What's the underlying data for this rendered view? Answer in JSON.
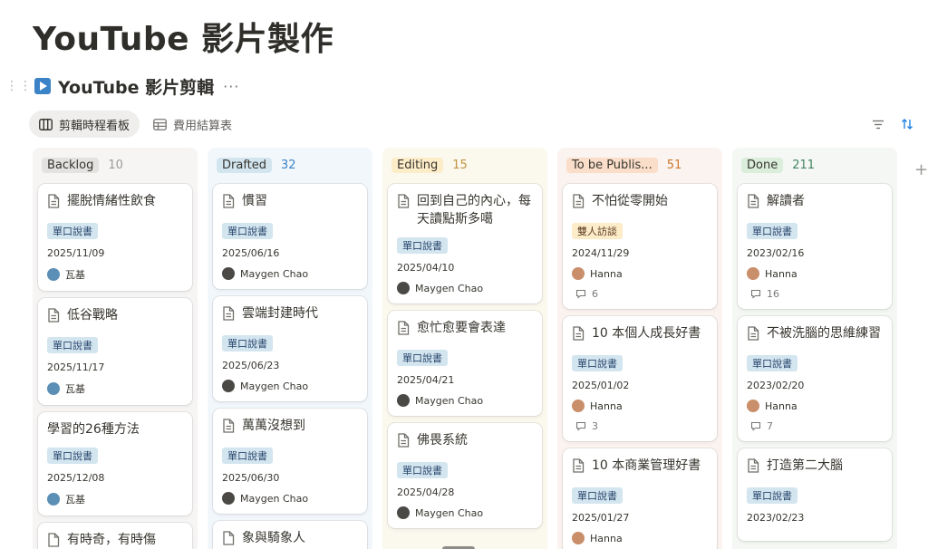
{
  "page": {
    "title": "YouTube 影片製作"
  },
  "database": {
    "title": "YouTube 影片剪輯",
    "more": "···"
  },
  "views": [
    {
      "label": "剪輯時程看板",
      "icon": "board-icon",
      "active": true
    },
    {
      "label": "費用結算表",
      "icon": "table-icon",
      "active": false
    }
  ],
  "toolbar": {
    "filter_icon": "filter-icon",
    "sort_icon": "sort-icon"
  },
  "colors": {
    "backlog_bg": "#f6f5f4",
    "backlog_tag": "#e3e2e0",
    "drafted_bg": "#f2f7fc",
    "drafted_tag": "#d3e5ef",
    "drafted_count": "#3b83c6",
    "editing_bg": "#fbf8ee",
    "editing_tag": "#fdecc8",
    "editing_count": "#c29343",
    "publish_bg": "#fbf3ef",
    "publish_tag": "#fadec9",
    "publish_count": "#cc782f",
    "done_bg": "#f4f7f3",
    "done_tag": "#dbeddb",
    "done_count": "#448361"
  },
  "columns": [
    {
      "label": "Backlog",
      "count": "10",
      "cards": [
        {
          "title": "擺脫情緒性飲食",
          "tag": "單口說書",
          "date": "2025/11/09",
          "person": "瓦基"
        },
        {
          "title": "低谷戰略",
          "tag": "單口說書",
          "date": "2025/11/17",
          "person": "瓦基"
        },
        {
          "title": "學習的26種方法",
          "tag": "單口說書",
          "date": "2025/12/08",
          "person": "瓦基"
        },
        {
          "title": "有時奇，有時傷"
        }
      ]
    },
    {
      "label": "Drafted",
      "count": "32",
      "cards": [
        {
          "title": "慣習",
          "tag": "單口說書",
          "date": "2025/06/16",
          "person": "Maygen Chao"
        },
        {
          "title": "雲端封建時代",
          "tag": "單口說書",
          "date": "2025/06/23",
          "person": "Maygen Chao"
        },
        {
          "title": "萬萬沒想到",
          "tag": "單口說書",
          "date": "2025/06/30",
          "person": "Maygen Chao"
        },
        {
          "title": "象與騎象人"
        }
      ]
    },
    {
      "label": "Editing",
      "count": "15",
      "cards": [
        {
          "title": "回到自己的內心，每天讀點斯多噶",
          "tag": "單口說書",
          "date": "2025/04/10",
          "person": "Maygen Chao"
        },
        {
          "title": "愈忙愈要會表達",
          "tag": "單口說書",
          "date": "2025/04/21",
          "person": "Maygen Chao"
        },
        {
          "title": "佛畏系統",
          "tag": "單口說書",
          "date": "2025/04/28",
          "person": "Maygen Chao"
        }
      ]
    },
    {
      "label": "To be Publis...",
      "count": "51",
      "cards": [
        {
          "title": "不怕從零開始",
          "tag": "雙人訪談",
          "date": "2024/11/29",
          "person": "Hanna",
          "comments": "6"
        },
        {
          "title": "10 本個人成長好書",
          "tag": "單口說書",
          "date": "2025/01/02",
          "person": "Hanna",
          "comments": "3"
        },
        {
          "title": "10 本商業管理好書",
          "tag": "單口說書",
          "date": "2025/01/27",
          "person": "Hanna"
        }
      ]
    },
    {
      "label": "Done",
      "count": "211",
      "cards": [
        {
          "title": "解讀者",
          "tag": "單口說書",
          "date": "2023/02/16",
          "person": "Hanna",
          "comments": "16"
        },
        {
          "title": "不被洗腦的思維練習",
          "tag": "單口說書",
          "date": "2023/02/20",
          "person": "Hanna",
          "comments": "7"
        },
        {
          "title": "打造第二大腦",
          "tag": "單口說書",
          "date": "2023/02/23"
        }
      ]
    }
  ]
}
